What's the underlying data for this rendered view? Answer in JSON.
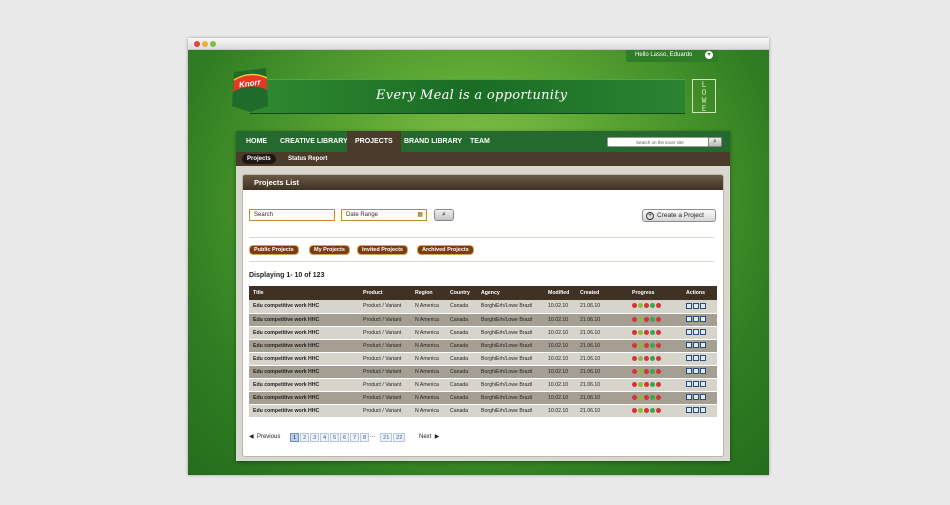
{
  "header": {
    "greeting": "Hello Lasso, Eduardo",
    "tagline": "Every Meal is a opportunity",
    "brand_logo": "Knorr",
    "agency_logo": "LOWE"
  },
  "nav": {
    "items": [
      "HOME",
      "CREATIVE LIBRARY",
      "PROJECTS",
      "BRAND LIBRARY",
      "TEAM"
    ],
    "active": "PROJECTS",
    "search_placeholder": "Search on the knorr site"
  },
  "subnav": {
    "items": [
      "Projects",
      "Status Report"
    ],
    "active": "Projects"
  },
  "panel": {
    "title": "Projects List",
    "search_placeholder": "Search",
    "date_placeholder": "Date Range",
    "create_label": "Create a Project",
    "filters": [
      "Public Projects",
      "My Projects",
      "Invited Projects",
      "Archived Projects"
    ],
    "displaying": "Displaying 1- 10 of 123"
  },
  "table": {
    "columns": [
      "Title",
      "Product",
      "Region",
      "Country",
      "Agency",
      "Modified",
      "Created",
      "Progress",
      "Actions"
    ],
    "rows": [
      [
        "Edu competitive work HHC",
        "Product / Variant",
        "N America",
        "Canada",
        "BorghiErh/Lowe Brazil",
        "10.02.10",
        "21.06.10"
      ],
      [
        "Edu competitive work HHC",
        "Product / Variant",
        "N America",
        "Canada",
        "BorghiErh/Lowe Brazil",
        "10.02.10",
        "21.06.10"
      ],
      [
        "Edu competitive work HHC",
        "Product / Variant",
        "N America",
        "Canada",
        "BorghiErh/Lowe Brazil",
        "10.02.10",
        "21.06.10"
      ],
      [
        "Edu competitive work HHC",
        "Product / Variant",
        "N America",
        "Canada",
        "BorghiErh/Lowe Brazil",
        "10.02.10",
        "21.06.10"
      ],
      [
        "Edu competitive work HHC",
        "Product / Variant",
        "N America",
        "Canada",
        "BorghiErh/Lowe Brazil",
        "10.02.10",
        "21.06.10"
      ],
      [
        "Edu competitive work HHC",
        "Product / Variant",
        "N America",
        "Canada",
        "BorghiErh/Lowe Brazil",
        "10.02.10",
        "21.06.10"
      ],
      [
        "Edu competitive work HHC",
        "Product / Variant",
        "N America",
        "Canada",
        "BorghiErh/Lowe Brazil",
        "10.02.10",
        "21.06.10"
      ],
      [
        "Edu competitive work HHC",
        "Product / Variant",
        "N America",
        "Canada",
        "BorghiErh/Lowe Brazil",
        "10.02.10",
        "21.06.10"
      ],
      [
        "Edu competitive work HHC",
        "Product / Variant",
        "N America",
        "Canada",
        "BorghiErh/Lowe Brazil",
        "10.02.10",
        "21.06.10"
      ]
    ],
    "progress_colors": [
      "#d6323a",
      "#8bbd3a",
      "#d6323a",
      "#3aa64a",
      "#d6323a"
    ],
    "action_icons": [
      "edit-icon",
      "pencil-icon",
      "share-icon"
    ]
  },
  "pagination": {
    "previous": "Previous",
    "next": "Next",
    "pages": [
      "1",
      "2",
      "3",
      "4",
      "5",
      "6",
      "7",
      "8",
      "...",
      "21",
      "22"
    ],
    "current": "1"
  },
  "colors": {
    "brand_green": "#24692e",
    "brown": "#3f3123",
    "filter_brown": "#7a3d12"
  }
}
